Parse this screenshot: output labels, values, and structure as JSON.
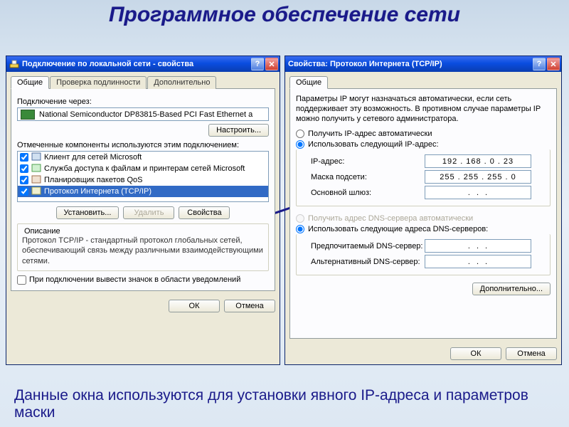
{
  "slide": {
    "title": "Программное обеспечение сети",
    "caption": "Данные окна используются для установки явного IP-адреса и параметров маски"
  },
  "left": {
    "title": "Подключение по локальной сети - свойства",
    "tabs": {
      "general": "Общие",
      "auth": "Проверка подлинности",
      "advanced": "Дополнительно"
    },
    "connect_via": "Подключение через:",
    "device": "National Semiconductor DP83815-Based PCI Fast Ethernet a",
    "configure": "Настроить...",
    "components_label": "Отмеченные компоненты используются этим подключением:",
    "items": {
      "i1": "Клиент для сетей Microsoft",
      "i2": "Служба доступа к файлам и принтерам сетей Microsoft",
      "i3": "Планировщик пакетов QoS",
      "i4": "Протокол Интернета (TCP/IP)"
    },
    "buttons": {
      "install": "Установить...",
      "remove": "Удалить",
      "props": "Свойства"
    },
    "desc_title": "Описание",
    "desc_text": "Протокол TCP/IP - стандартный протокол глобальных сетей, обеспечивающий связь между различными взаимодействующими сетями.",
    "tray_check": "При подключении вывести значок в области уведомлений",
    "ok": "ОК",
    "cancel": "Отмена"
  },
  "right": {
    "title": "Свойства: Протокол Интернета (TCP/IP)",
    "tab": "Общие",
    "intro": "Параметры IP могут назначаться автоматически, если сеть поддерживает эту возможность. В противном случае параметры IP можно получить у сетевого администратора.",
    "r1": "Получить IP-адрес автоматически",
    "r2": "Использовать следующий IP-адрес:",
    "ip_label": "IP-адрес:",
    "ip": {
      "a": "192",
      "b": "168",
      "c": "0",
      "d": "23"
    },
    "mask_label": "Маска подсети:",
    "mask": {
      "a": "255",
      "b": "255",
      "c": "255",
      "d": "0"
    },
    "gw_label": "Основной шлюз:",
    "r3": "Получить адрес DNS-сервера автоматически",
    "r4": "Использовать следующие адреса DNS-серверов:",
    "dns1_label": "Предпочитаемый DNS-сервер:",
    "dns2_label": "Альтернативный DNS-сервер:",
    "advanced": "Дополнительно...",
    "ok": "ОК",
    "cancel": "Отмена"
  }
}
